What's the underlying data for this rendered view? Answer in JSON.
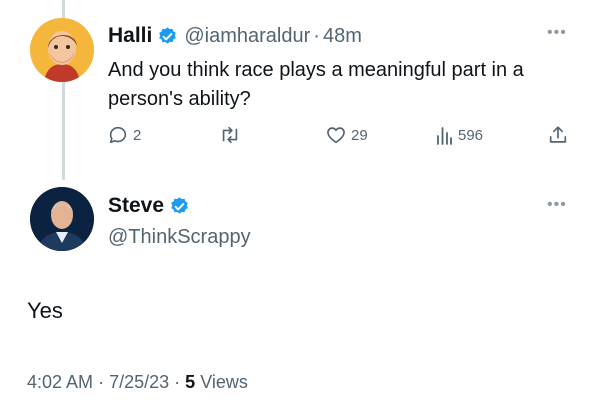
{
  "original_tweet": {
    "display_name": "Halli",
    "handle": "@iamharaldur",
    "separator": "·",
    "time_ago": "48m",
    "text": "And you think race plays a meaningful part in a person's ability?",
    "reply_count": "2",
    "like_count": "29",
    "view_count": "596"
  },
  "reply_tweet": {
    "display_name": "Steve",
    "handle": "@ThinkScrappy",
    "text": "Yes",
    "time": "4:02 AM",
    "sep1": "·",
    "date": "7/25/23",
    "sep2": "·",
    "views_count": "5",
    "views_label": "Views"
  },
  "icons": {
    "verified": "verified-badge-icon",
    "more": "more-horizontal-icon",
    "reply": "reply-icon",
    "retweet": "retweet-icon",
    "like": "heart-icon",
    "views": "views-chart-icon",
    "share": "share-icon"
  },
  "colors": {
    "verified_blue": "#1d9bf0",
    "secondary_text": "#536471",
    "primary_text": "#0f1419",
    "thread_line": "#cfd9de"
  }
}
